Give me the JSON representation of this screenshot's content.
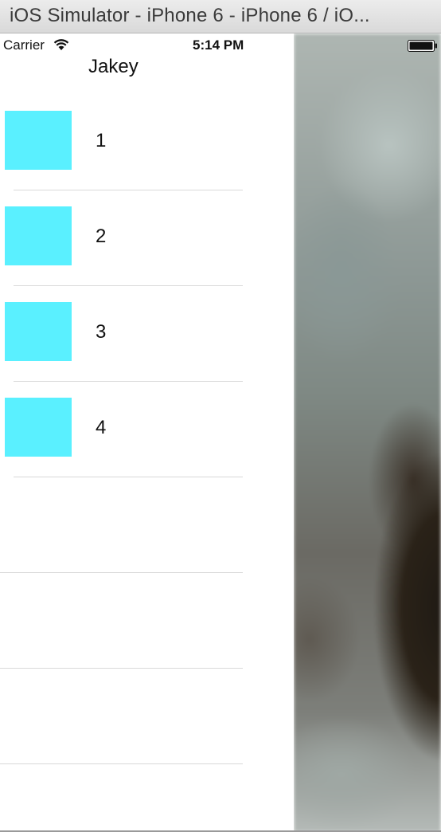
{
  "window": {
    "title": "iOS Simulator - iPhone 6 - iPhone 6 / iO..."
  },
  "status_bar": {
    "carrier": "Carrier",
    "time": "5:14 PM",
    "wifi_icon": "wifi-icon",
    "battery_icon": "battery-icon"
  },
  "menu": {
    "title": "Jakey",
    "rows": [
      {
        "label": "1",
        "thumb_color": "#5af0ff"
      },
      {
        "label": "2",
        "thumb_color": "#5af0ff"
      },
      {
        "label": "3",
        "thumb_color": "#5af0ff"
      },
      {
        "label": "4",
        "thumb_color": "#5af0ff"
      },
      {
        "label": ""
      },
      {
        "label": ""
      },
      {
        "label": ""
      }
    ]
  },
  "colors": {
    "thumb": "#5af0ff",
    "divider": "#d9d9d9"
  }
}
